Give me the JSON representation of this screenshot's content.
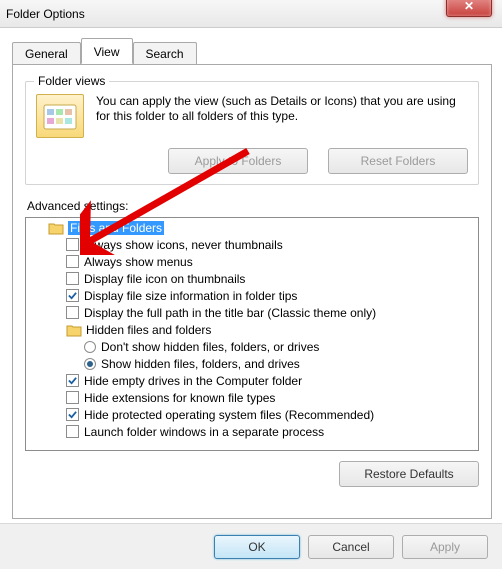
{
  "window": {
    "title": "Folder Options"
  },
  "tabs": {
    "general": "General",
    "view": "View",
    "search": "Search",
    "active": 1
  },
  "folder_views": {
    "legend": "Folder views",
    "text": "You can apply the view (such as Details or Icons) that you are using for this folder to all folders of this type.",
    "apply_btn": "Apply to Folders",
    "reset_btn": "Reset Folders"
  },
  "advanced": {
    "label": "Advanced settings:",
    "root": "Files and Folders",
    "hidden_node": "Hidden files and folders",
    "items": [
      {
        "type": "check",
        "checked": false,
        "label": "Always show icons, never thumbnails"
      },
      {
        "type": "check",
        "checked": false,
        "label": "Always show menus"
      },
      {
        "type": "check",
        "checked": false,
        "label": "Display file icon on thumbnails"
      },
      {
        "type": "check",
        "checked": true,
        "label": "Display file size information in folder tips"
      },
      {
        "type": "check",
        "checked": false,
        "label": "Display the full path in the title bar (Classic theme only)"
      }
    ],
    "hidden_options": [
      {
        "type": "radio",
        "checked": false,
        "label": "Don't show hidden files, folders, or drives"
      },
      {
        "type": "radio",
        "checked": true,
        "label": "Show hidden files, folders, and drives"
      }
    ],
    "items2": [
      {
        "type": "check",
        "checked": true,
        "label": "Hide empty drives in the Computer folder"
      },
      {
        "type": "check",
        "checked": false,
        "label": "Hide extensions for known file types"
      },
      {
        "type": "check",
        "checked": true,
        "label": "Hide protected operating system files (Recommended)"
      },
      {
        "type": "check",
        "checked": false,
        "label": "Launch folder windows in a separate process"
      }
    ],
    "restore_btn": "Restore Defaults"
  },
  "footer": {
    "ok": "OK",
    "cancel": "Cancel",
    "apply": "Apply"
  }
}
